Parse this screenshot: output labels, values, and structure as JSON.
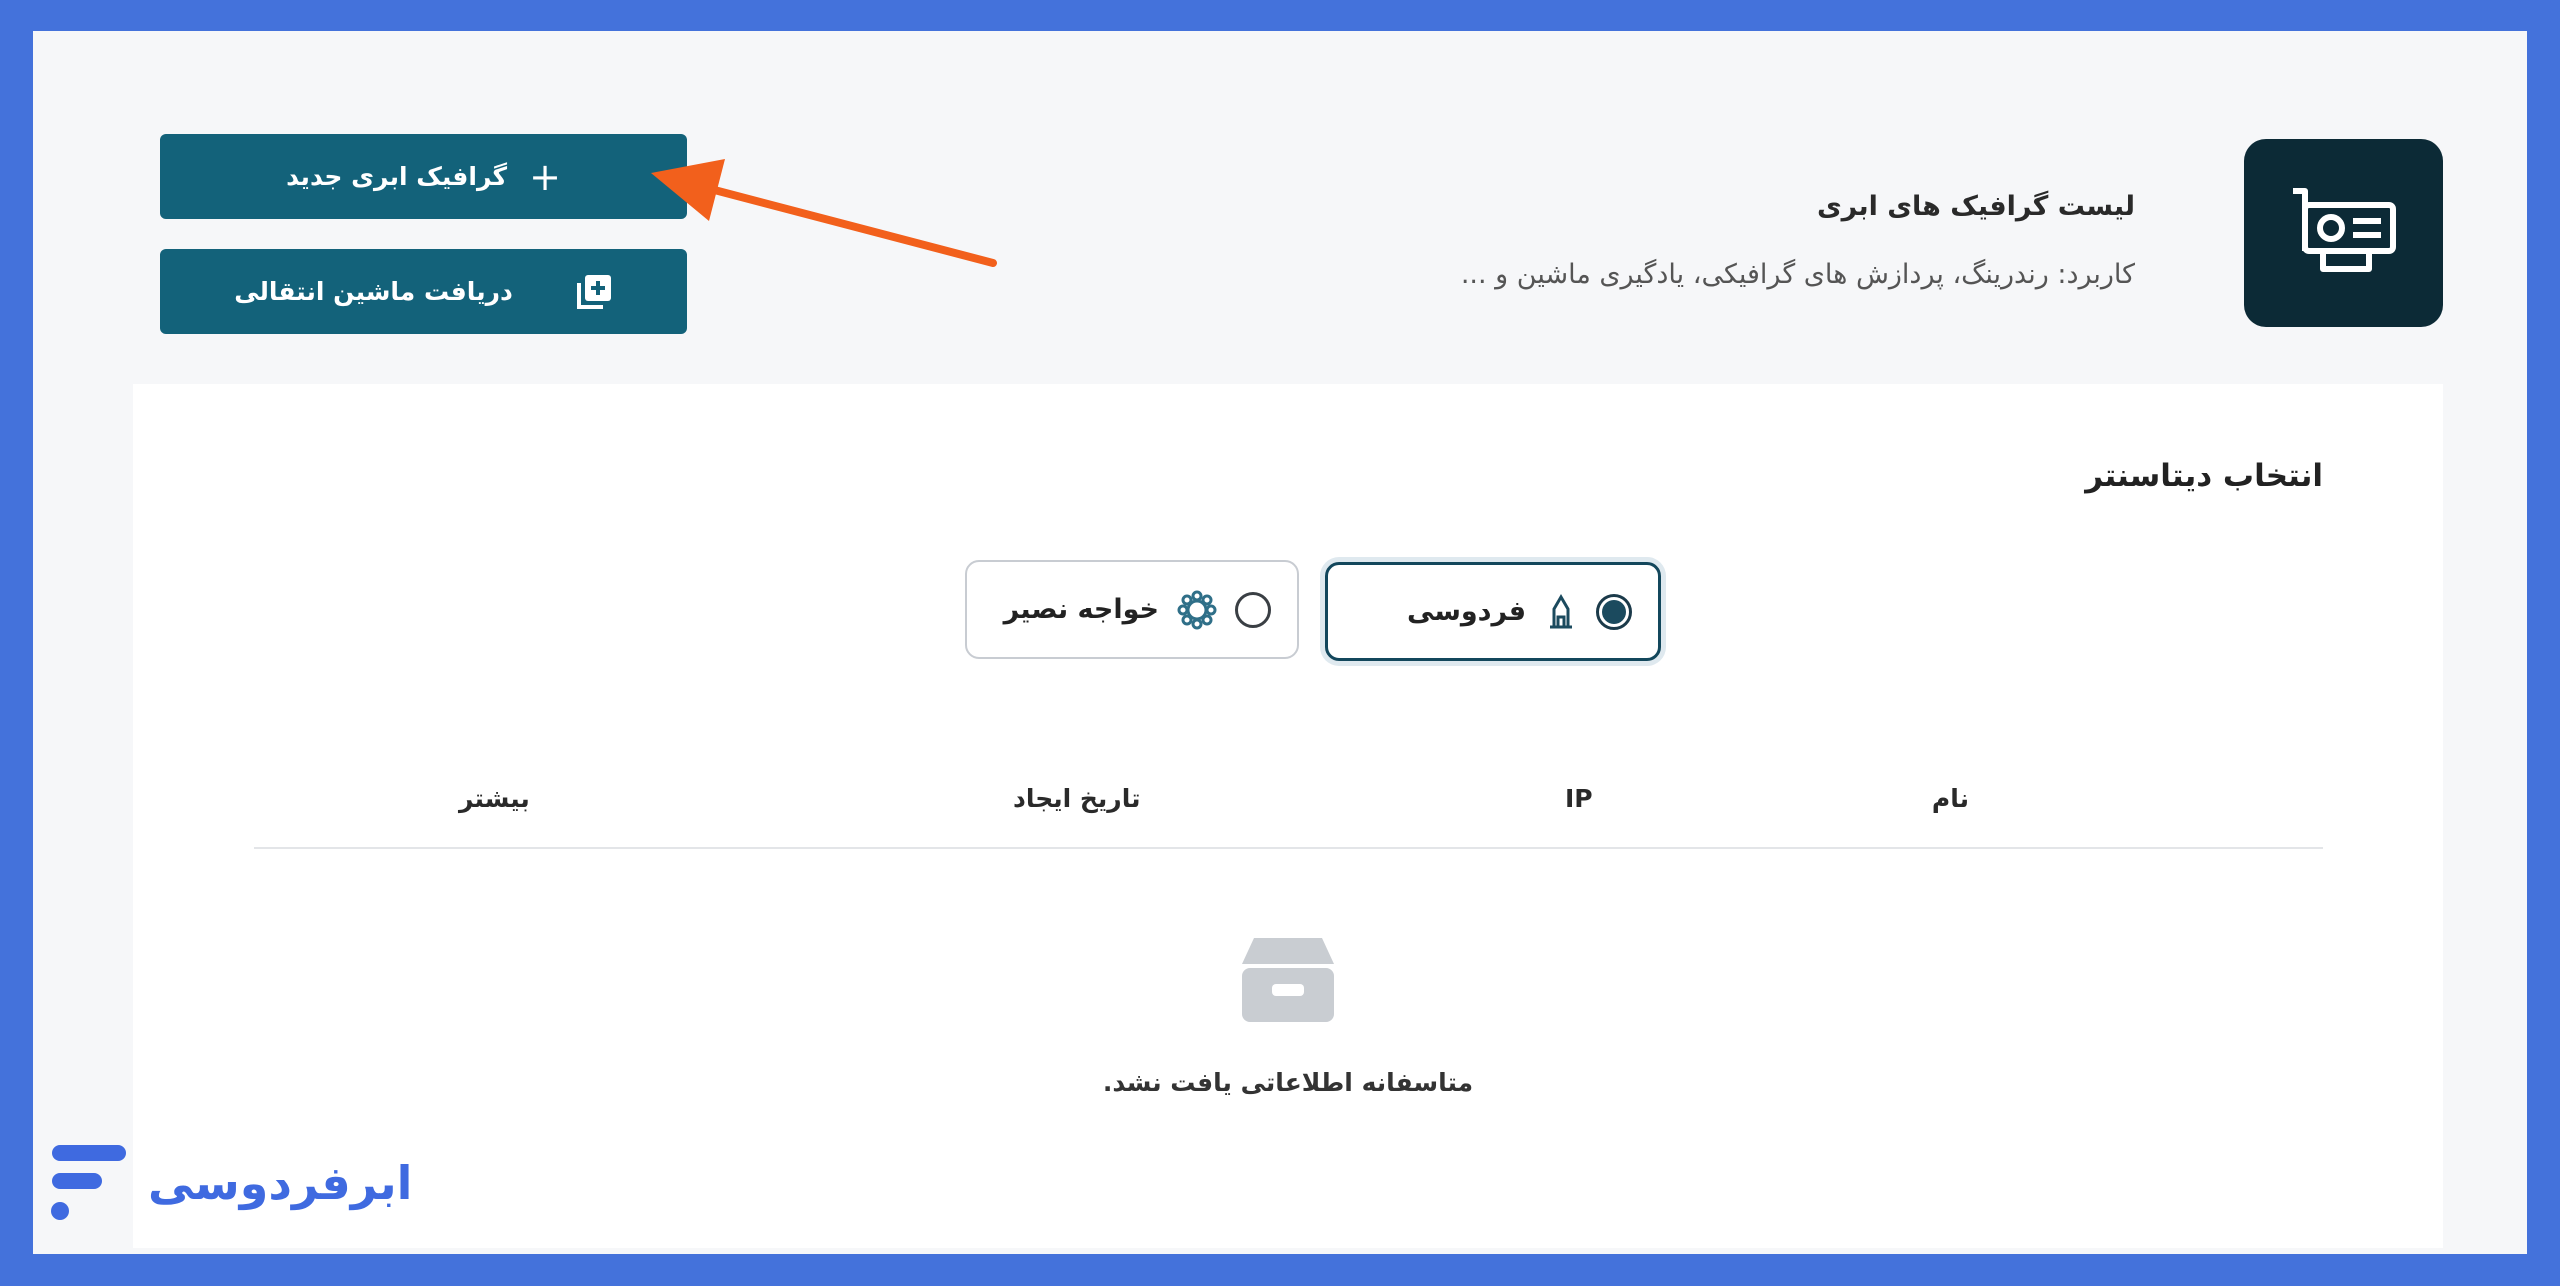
{
  "header": {
    "title": "لیست گرافیک های ابری",
    "subtitle": "کاربرد: رندرینگ، پردازش های گرافیکی، یادگیری ماشین و ..."
  },
  "actions": {
    "new_gpu_label": "گرافیک ابری جدید",
    "transfer_label": "دریافت ماشین انتقالی"
  },
  "datacenter": {
    "title": "انتخاب دیتاسنتر",
    "options": [
      {
        "label": "فردوسی",
        "selected": true
      },
      {
        "label": "خواجه نصیر",
        "selected": false
      }
    ]
  },
  "table": {
    "columns": [
      "نام",
      "IP",
      "تاریخ ایجاد",
      "بیشتر"
    ],
    "empty_message": "متاسفانه اطلاعاتی یافت نشد."
  },
  "brand": {
    "name": "ابرفردوسی",
    "color": "#3f6ae0"
  },
  "colors": {
    "primary_button": "#13627a",
    "annotation_arrow": "#f2601c",
    "frame": "#4472db"
  },
  "icons": {
    "gpu_card": "gpu-card-icon",
    "plus": "plus-icon",
    "copy_add": "copy-add-icon",
    "empty": "empty-box-icon"
  }
}
